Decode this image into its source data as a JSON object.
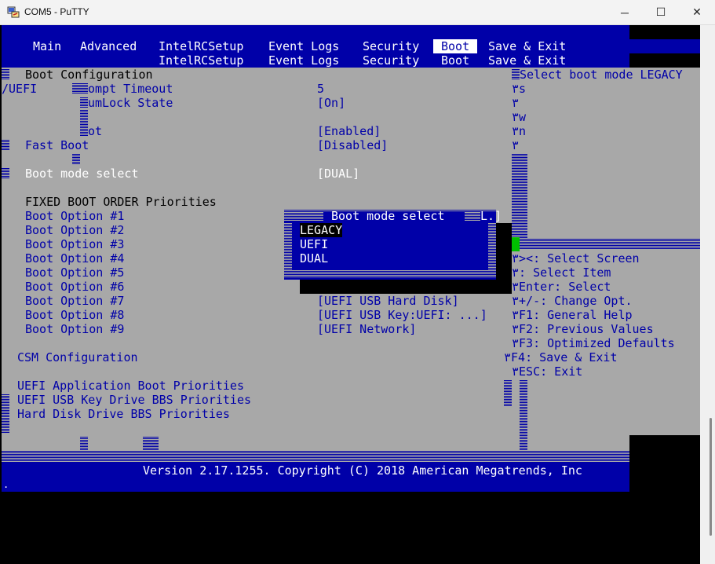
{
  "window": {
    "title": "COM5 - PuTTY",
    "icon": "putty-icon",
    "controls": {
      "minimize": "─",
      "maximize": "☐",
      "close": "✕"
    }
  },
  "menu": {
    "main": "Main",
    "advanced": "Advanced",
    "intel": "IntelRCSetup",
    "event": "Event Logs",
    "security": "Security",
    "boot": "Boot",
    "save_exit": "Save & Exit"
  },
  "left": {
    "boot_configuration": "Boot Configuration",
    "uefi_fragment": "/UEFI",
    "prompt_timeout": "ompt Timeout",
    "numlock": "umLock State",
    "ot_fragment": "ot",
    "fast_boot": "Fast Boot",
    "boot_mode_select": "Boot mode select",
    "fixed_header": "FIXED BOOT ORDER Priorities",
    "boot_options": [
      "Boot Option #1",
      "Boot Option #2",
      "Boot Option #3",
      "Boot Option #4",
      "Boot Option #5",
      "Boot Option #6",
      "Boot Option #7",
      "Boot Option #8",
      "Boot Option #9"
    ],
    "csm": "CSM Configuration",
    "uefi_app": "UEFI Application Boot Priorities",
    "uefi_usb_key": "UEFI USB Key Drive BBS Priorities",
    "hdd_bbs": "Hard Disk Drive BBS Priorities"
  },
  "values": {
    "timeout": "5",
    "numlock": "[On]",
    "ot": "[Enabled]",
    "fast_boot": "[Disabled]",
    "boot_mode": "[DUAL]",
    "opt7": "[UEFI USB Hard Disk]",
    "opt8": "[UEFI USB Key:UEFI: ...]",
    "opt9": "[UEFI Network]",
    "bracket_fragment": "L.]"
  },
  "popup": {
    "title": "Boot mode select",
    "options": [
      "LEGACY",
      "UEFI",
      "DUAL"
    ],
    "selected": "LEGACY"
  },
  "help": {
    "top": "Select boot mode LEGACY",
    "frags": [
      "٣s",
      "٣",
      "٣w",
      "٣n",
      "٣"
    ],
    "keys": [
      "٣><: Select Screen",
      "٣: Select Item",
      "٣Enter: Select",
      "٣+/-: Change Opt.",
      "٣F1: General Help",
      "٣F2: Previous Values",
      "٣F3: Optimized Defaults",
      "٣F4: Save & Exit",
      "٣ESC: Exit"
    ]
  },
  "footer": {
    "version": "Version 2.17.1255. Copyright (C) 2018 American Megatrends, Inc"
  },
  "prompt": "."
}
